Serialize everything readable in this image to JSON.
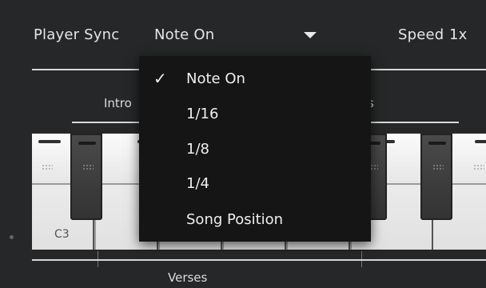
{
  "header": {
    "player_sync_label": "Player Sync",
    "player_sync_value": "Note On",
    "speed_label": "Speed",
    "speed_value": "1x"
  },
  "sections": {
    "intro_label": "Intro",
    "other_label": "s",
    "verses_label": "Verses"
  },
  "keyboard": {
    "key_label": "C3"
  },
  "dropdown": {
    "check_glyph": "✓",
    "items": [
      {
        "label": "Note On",
        "selected": true
      },
      {
        "label": "1/16",
        "selected": false
      },
      {
        "label": "1/8",
        "selected": false
      },
      {
        "label": "1/4",
        "selected": false
      },
      {
        "label": "Song Position",
        "selected": false
      }
    ]
  }
}
